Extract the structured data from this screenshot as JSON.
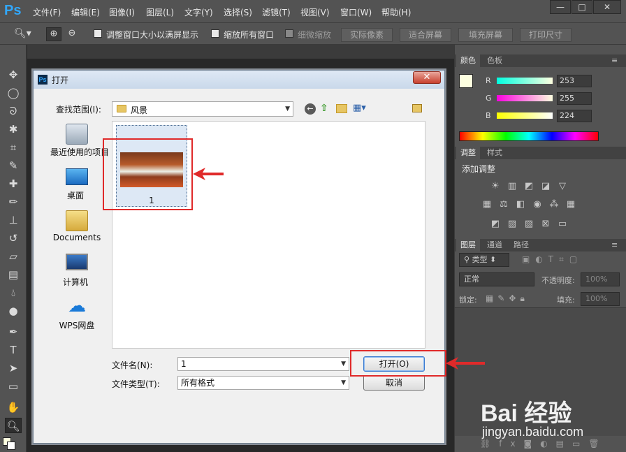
{
  "app": {
    "logo": "Ps"
  },
  "menu": [
    "文件(F)",
    "编辑(E)",
    "图像(I)",
    "图层(L)",
    "文字(Y)",
    "选择(S)",
    "滤镜(T)",
    "视图(V)",
    "窗口(W)",
    "帮助(H)"
  ],
  "window_controls": {
    "minimize": "—",
    "maximize": "□",
    "close": "✕"
  },
  "options_bar": {
    "resize_windows": "调整窗口大小以满屏显示",
    "zoom_all": "缩放所有窗口",
    "scrubby_zoom": "细微缩放",
    "actual_pixels": "实际像素",
    "fit_screen": "适合屏幕",
    "fill_screen": "填充屏幕",
    "print_size": "打印尺寸"
  },
  "color_panel": {
    "tabs": [
      "颜色",
      "色板"
    ],
    "labels": {
      "r": "R",
      "g": "G",
      "b": "B"
    },
    "values": {
      "r": "253",
      "g": "255",
      "b": "224"
    },
    "foreground_color": "#fdffe0"
  },
  "adjustments_panel": {
    "tabs": [
      "调整",
      "样式"
    ],
    "title": "添加调整"
  },
  "layers_panel": {
    "tabs": [
      "图层",
      "通道",
      "路径"
    ],
    "kind_filter": "类型",
    "blend_mode": "正常",
    "opacity_label": "不透明度:",
    "opacity_value": "100%",
    "lock_label": "锁定:",
    "fill_label": "填充:",
    "fill_value": "100%"
  },
  "dialog": {
    "title": "打开",
    "look_in_label": "查找范围(I):",
    "look_in_value": "风景",
    "places": [
      {
        "label": "最近使用的项目",
        "icon": "recent-items-icon"
      },
      {
        "label": "桌面",
        "icon": "desktop-icon"
      },
      {
        "label": "Documents",
        "icon": "documents-folder-icon"
      },
      {
        "label": "计算机",
        "icon": "computer-icon"
      },
      {
        "label": "WPS网盘",
        "icon": "cloud-drive-icon"
      }
    ],
    "files": [
      {
        "name": "1"
      }
    ],
    "filename_label": "文件名(N):",
    "filename_value": "1",
    "filetype_label": "文件类型(T):",
    "filetype_value": "所有格式",
    "open_button": "打开(O)",
    "cancel_button": "取消",
    "close_button": "✕"
  },
  "watermark": {
    "brand": "Bai 经验",
    "url": "jingyan.baidu.com"
  }
}
